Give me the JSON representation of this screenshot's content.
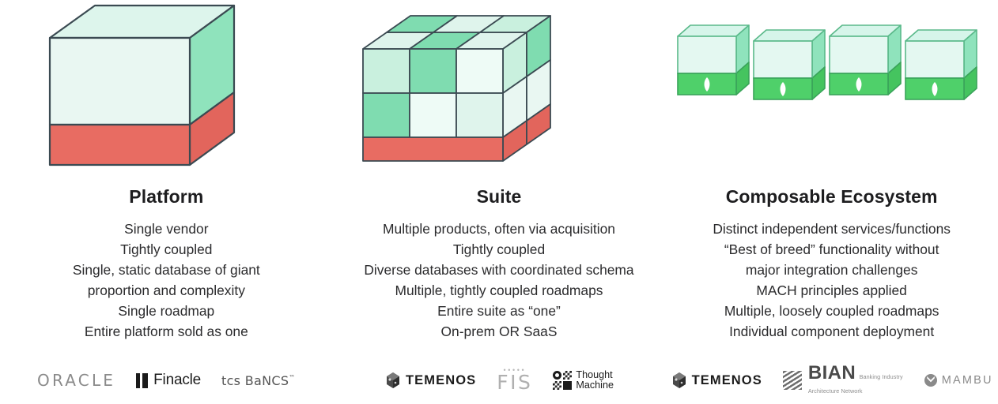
{
  "colors": {
    "cube_outline": "#3b4a52",
    "cube_front_pale": "#e9f7f2",
    "cube_top_pale": "#dff4ec",
    "cube_side_green": "#8fe3bc",
    "cube_mid_green": "#7fdcb0",
    "cube_light_green": "#c9f0de",
    "cube_red": "#e86c62",
    "cube_red_side": "#e2655c",
    "composable_green": "#4fd06a",
    "composable_green_side": "#45c45f",
    "composable_outline": "#3aa45a",
    "leaf_white": "#ffffff",
    "heading_text": "#1d1d1f",
    "body_text": "#2b2b2d"
  },
  "columns": [
    {
      "id": "platform",
      "graphic": "single-monolith-cube",
      "heading": "Platform",
      "lines": [
        "Single vendor",
        "Tightly coupled",
        "Single, static database of giant",
        "proportion and complexity",
        "Single roadmap",
        "Entire platform sold as one"
      ],
      "logos": [
        {
          "id": "oracle",
          "name": "ORACLE"
        },
        {
          "id": "finacle",
          "name": "Finacle"
        },
        {
          "id": "tcs-bancs",
          "name": "tcs BaNCS",
          "trademark": "™"
        }
      ]
    },
    {
      "id": "suite",
      "graphic": "segmented-cube-grid",
      "heading": "Suite",
      "lines": [
        "Multiple products, often via acquisition",
        "Tightly coupled",
        "Diverse databases with coordinated schema",
        "Multiple, tightly coupled roadmaps",
        "Entire suite as “one”",
        "On-prem OR SaaS"
      ],
      "logos": [
        {
          "id": "temenos",
          "name": "TEMENOS"
        },
        {
          "id": "fis",
          "name": "FIS"
        },
        {
          "id": "thought-machine",
          "name_line1": "Thought",
          "name_line2": "Machine"
        }
      ]
    },
    {
      "id": "composable-ecosystem",
      "graphic": "four-separate-cubes",
      "heading": "Composable Ecosystem",
      "lines": [
        "Distinct independent services/functions",
        "“Best of breed” functionality without",
        "major integration challenges",
        "MACH principles applied",
        "Multiple, loosely coupled roadmaps",
        "Individual component deployment"
      ],
      "logos": [
        {
          "id": "temenos",
          "name": "TEMENOS"
        },
        {
          "id": "bian",
          "name": "BIAN",
          "sub_line1": "Banking Industry",
          "sub_line2": "Architecture Network"
        },
        {
          "id": "mambu",
          "name": "MAMBU"
        }
      ]
    }
  ]
}
